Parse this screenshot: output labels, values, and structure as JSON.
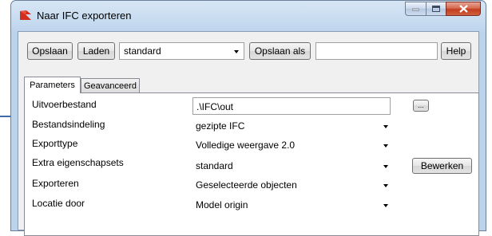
{
  "window": {
    "title": "Naar IFC exporteren",
    "icon": "ifc-export-icon"
  },
  "toolbar": {
    "save_label": "Opslaan",
    "load_label": "Laden",
    "preset_value": "standard",
    "save_as_label": "Opslaan als",
    "save_as_name": "",
    "help_label": "Help"
  },
  "tabs": [
    {
      "label": "Parameters",
      "active": true
    },
    {
      "label": "Geavanceerd",
      "active": false
    }
  ],
  "parameters": {
    "output_file": {
      "label": "Uitvoerbestand",
      "value": ".\\IFC\\out",
      "browse_label": "..."
    },
    "file_format": {
      "label": "Bestandsindeling",
      "value": "gezipte IFC"
    },
    "export_type": {
      "label": "Exporttype",
      "value": "Volledige weergave 2.0"
    },
    "extra_property_sets": {
      "label": "Extra eigenschapsets",
      "value": "standard",
      "edit_label": "Bewerken"
    },
    "export": {
      "label": "Exporteren",
      "value": "Geselecteerde objecten"
    },
    "location_by": {
      "label": "Locatie door",
      "value": "Model origin"
    }
  },
  "colors": {
    "titlebar": "#c4d9ef",
    "close_button": "#c23c1f",
    "dialog_bg": "#f0f0f0",
    "pointer_arrow": "#3d6aa8"
  }
}
